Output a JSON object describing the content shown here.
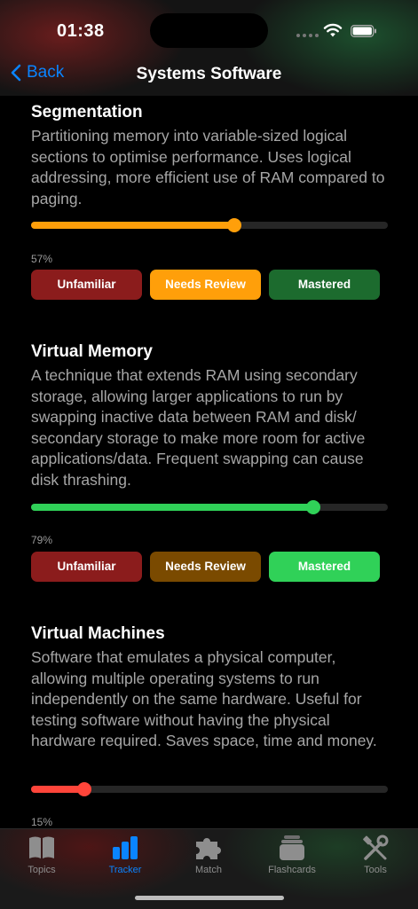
{
  "status": {
    "time": "01:38"
  },
  "nav": {
    "back_label": "Back",
    "title": "Systems Software"
  },
  "buttons": {
    "unfamiliar": "Unfamiliar",
    "needs_review": "Needs Review",
    "mastered": "Mastered"
  },
  "colors": {
    "accent": "#0a84ff",
    "unfamiliar_dim": "#8b1c1c",
    "review_active": "#ff9f0a",
    "review_dim": "#7a4a00",
    "mastered_dim": "#1c6b2e",
    "mastered_active": "#30d158",
    "red_progress": "#ff453a",
    "orange_progress": "#ff9f0a",
    "green_progress": "#30d158"
  },
  "topics": [
    {
      "title": "Segmentation",
      "description": "Partitioning memory into variable-sized logical sections to optimise performance. Uses logical addressing, more efficient use of RAM compared to paging.",
      "progress": 0.57,
      "progress_label": "57%",
      "selected": "needs_review"
    },
    {
      "title": "Virtual Memory",
      "description": "A technique that extends RAM using secondary storage, allowing larger applications to run by swapping inactive data between RAM and disk/ secondary storage to make more room for active applications/data. Frequent swapping can cause disk thrashing.",
      "progress": 0.79,
      "progress_label": "79%",
      "selected": "mastered"
    },
    {
      "title": "Virtual Machines",
      "description": "Software that emulates a physical computer, allowing multiple operating systems to run independently on the same hardware. Useful for testing software without having the physical hardware required. Saves space, time and money.",
      "progress": 0.15,
      "progress_label": "15%",
      "selected": "unfamiliar"
    }
  ],
  "tabs": [
    {
      "label": "Topics",
      "icon": "book-icon",
      "active": false
    },
    {
      "label": "Tracker",
      "icon": "bar-chart-icon",
      "active": true
    },
    {
      "label": "Match",
      "icon": "puzzle-icon",
      "active": false
    },
    {
      "label": "Flashcards",
      "icon": "card-stack-icon",
      "active": false
    },
    {
      "label": "Tools",
      "icon": "wrench-screwdriver-icon",
      "active": false
    }
  ]
}
